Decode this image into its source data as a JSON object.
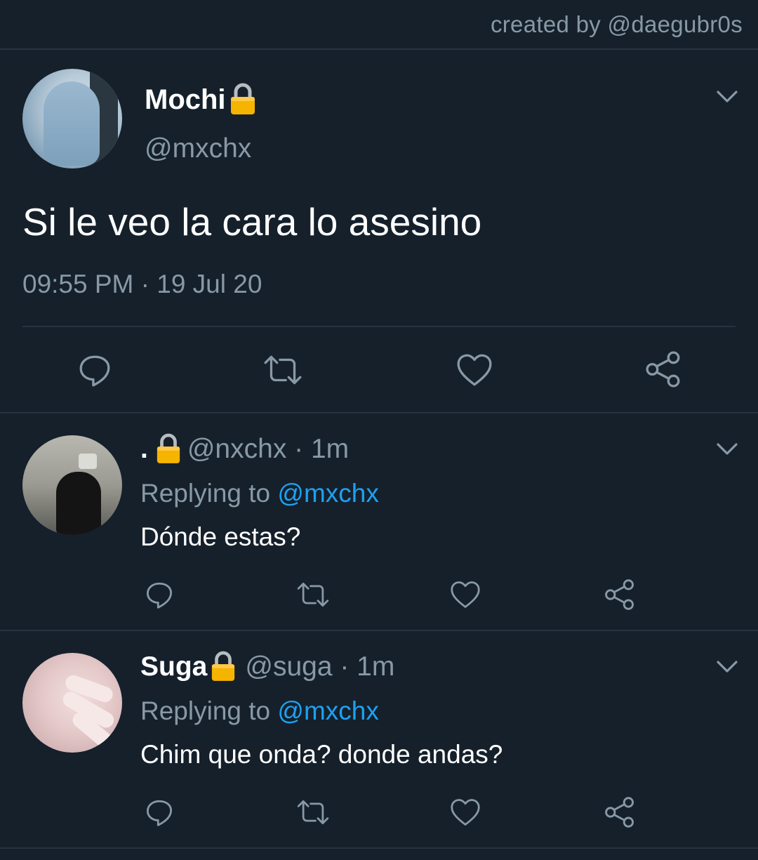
{
  "credit": "created by @daegubr0s",
  "main_tweet": {
    "name": "Mochi",
    "handle": "@mxchx",
    "text": "Si le veo la cara lo asesino",
    "timestamp": "09:55 PM · 19 Jul 20"
  },
  "replies": [
    {
      "name": ".",
      "handle_time": "@nxchx · 1m",
      "replying_prefix": "Replying to ",
      "replying_mention": "@mxchx",
      "text": "Dónde estas?"
    },
    {
      "name": "Suga",
      "handle_time": "@suga · 1m",
      "replying_prefix": "Replying to ",
      "replying_mention": "@mxchx",
      "text": "Chim que onda? donde andas?"
    }
  ],
  "colors": {
    "background": "#15202b",
    "divider": "#253341",
    "secondary_text": "#8899a6",
    "link": "#1da1f2",
    "lock": "#f4b400"
  },
  "icons": [
    "lock-icon",
    "chevron-down-icon",
    "reply-icon",
    "retweet-icon",
    "like-icon",
    "share-icon"
  ]
}
